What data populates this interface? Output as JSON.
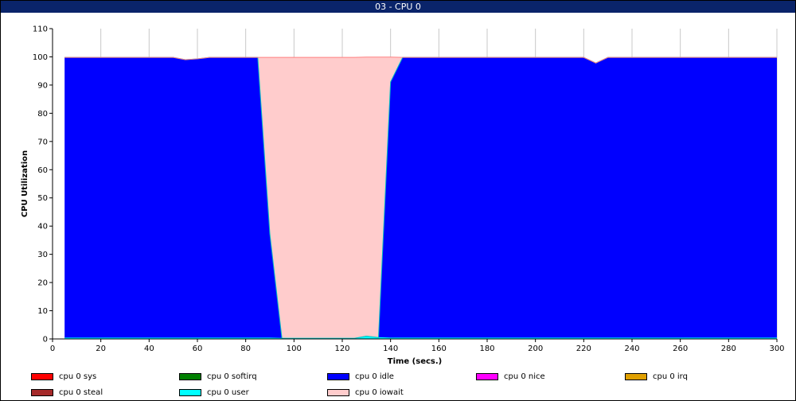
{
  "window": {
    "title": "03 - CPU 0"
  },
  "chart_data": {
    "type": "area",
    "stacked": true,
    "xlabel": "Time (secs.)",
    "ylabel": "CPU Utilization",
    "xlim": [
      0,
      300
    ],
    "ylim": [
      0,
      110
    ],
    "xticks": [
      0,
      20,
      40,
      60,
      80,
      100,
      120,
      140,
      160,
      180,
      200,
      220,
      240,
      260,
      280,
      300
    ],
    "yticks": [
      0,
      10,
      20,
      30,
      40,
      50,
      60,
      70,
      80,
      90,
      100,
      110
    ],
    "grid": "vertical",
    "legend_position": "bottom",
    "stack_order": [
      "cpu 0 user",
      "cpu 0 idle",
      "cpu 0 iowait"
    ],
    "series": [
      {
        "name": "cpu 0 user",
        "color": "#00ffff",
        "x": [
          5,
          85,
          90,
          95,
          125,
          130,
          135,
          140,
          145,
          300
        ],
        "values": [
          0.3,
          0.3,
          0.3,
          0.2,
          0.2,
          1.0,
          0.5,
          0.3,
          0.3,
          0.3
        ]
      },
      {
        "name": "cpu 0 idle",
        "color": "#0000ff",
        "x": [
          5,
          50,
          55,
          60,
          65,
          85,
          90,
          95,
          125,
          130,
          135,
          140,
          145,
          220,
          225,
          230,
          300
        ],
        "values": [
          99.5,
          99.5,
          98.7,
          99.0,
          99.5,
          99.5,
          37.0,
          0,
          0,
          0,
          0,
          90.8,
          99.5,
          99.5,
          97.5,
          99.5,
          99.5
        ]
      },
      {
        "name": "cpu 0 iowait",
        "color": "#ffcccc",
        "x": [
          5,
          85,
          90,
          95,
          125,
          130,
          135,
          140,
          145,
          300
        ],
        "values": [
          0,
          0,
          62.5,
          99.6,
          99.6,
          98.9,
          99.4,
          8.8,
          0,
          0
        ]
      }
    ],
    "legend": [
      {
        "name": "cpu 0 sys",
        "color": "#ff0000"
      },
      {
        "name": "cpu 0 softirq",
        "color": "#008000"
      },
      {
        "name": "cpu 0 idle",
        "color": "#0000ff"
      },
      {
        "name": "cpu 0 nice",
        "color": "#ff00ff"
      },
      {
        "name": "cpu 0 irq",
        "color": "#e0a000"
      },
      {
        "name": "cpu 0 steal",
        "color": "#a52a2a"
      },
      {
        "name": "cpu 0 user",
        "color": "#00ffff"
      },
      {
        "name": "cpu 0 iowait",
        "color": "#ffcccc"
      }
    ]
  }
}
